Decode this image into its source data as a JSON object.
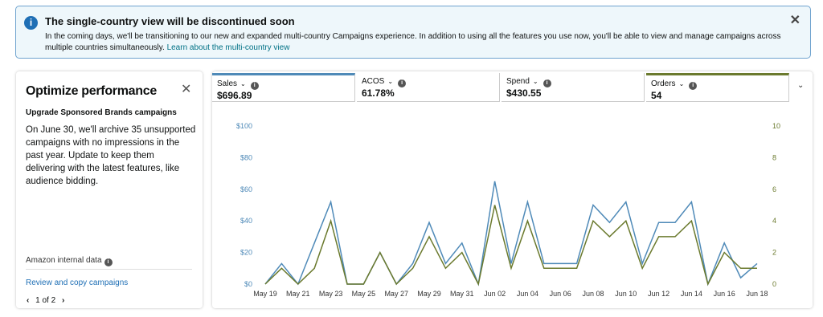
{
  "banner": {
    "icon": "info-icon",
    "title": "The single-country view will be discontinued soon",
    "body": "In the coming days, we'll be transitioning to our new and expanded multi-country Campaigns experience. In addition to using all the features you use now, you'll be able to view and manage campaigns across multiple countries simultaneously.",
    "link": "Learn about the multi-country view",
    "close": "✕"
  },
  "card": {
    "title": "Optimize performance",
    "close": "✕",
    "subtitle": "Upgrade Sponsored Brands campaigns",
    "body": "On June 30, we'll archive 35 unsupported campaigns with no impressions in the past year. Update to keep them delivering with the latest features, like audience bidding.",
    "internal_label": "Amazon internal data",
    "link": "Review and copy campaigns",
    "pager": {
      "prev": "‹",
      "text": "1 of 2",
      "next": "›"
    }
  },
  "metrics": [
    {
      "label": "Sales",
      "value": "$696.89",
      "selected_color": "#4f8ab8"
    },
    {
      "label": "ACOS",
      "value": "61.78%",
      "selected_color": ""
    },
    {
      "label": "Spend",
      "value": "$430.55",
      "selected_color": ""
    },
    {
      "label": "Orders",
      "value": "54",
      "selected_color": "#6b7a2e"
    }
  ],
  "chart_data": {
    "type": "line",
    "x": [
      "May 19",
      "May 20",
      "May 21",
      "May 22",
      "May 23",
      "May 24",
      "May 25",
      "May 26",
      "May 27",
      "May 28",
      "May 29",
      "May 30",
      "May 31",
      "Jun 01",
      "Jun 02",
      "Jun 03",
      "Jun 04",
      "Jun 05",
      "Jun 06",
      "Jun 07",
      "Jun 08",
      "Jun 09",
      "Jun 10",
      "Jun 11",
      "Jun 12",
      "Jun 13",
      "Jun 14",
      "Jun 15",
      "Jun 16",
      "Jun 17",
      "Jun 18"
    ],
    "x_tick_labels": [
      "May 19",
      "May 21",
      "May 23",
      "May 25",
      "May 27",
      "May 29",
      "May 31",
      "Jun 02",
      "Jun 04",
      "Jun 06",
      "Jun 08",
      "Jun 10",
      "Jun 12",
      "Jun 14",
      "Jun 16",
      "Jun 18"
    ],
    "series": [
      {
        "name": "Sales",
        "axis": "left",
        "color": "#4f8ab8",
        "values": [
          0,
          13,
          0,
          26,
          52,
          0,
          0,
          20,
          0,
          13,
          39,
          13,
          26,
          0,
          65,
          13,
          52,
          13,
          13,
          13,
          50,
          39,
          52,
          13,
          39,
          39,
          52,
          0,
          26,
          4,
          13
        ]
      },
      {
        "name": "Orders",
        "axis": "right",
        "color": "#6b7a2e",
        "values": [
          0,
          1,
          0,
          1,
          4,
          0,
          0,
          2,
          0,
          1,
          3,
          1,
          2,
          0,
          5,
          1,
          4,
          1,
          1,
          1,
          4,
          3,
          4,
          1,
          3,
          3,
          4,
          0,
          2,
          1,
          1
        ]
      }
    ],
    "left_axis": {
      "ticks": [
        "$0",
        "$20",
        "$40",
        "$60",
        "$80",
        "$100"
      ],
      "ylim": [
        0,
        100
      ]
    },
    "right_axis": {
      "ticks": [
        "0",
        "2",
        "4",
        "6",
        "8",
        "10"
      ],
      "ylim": [
        0,
        10
      ]
    },
    "grid": false
  }
}
